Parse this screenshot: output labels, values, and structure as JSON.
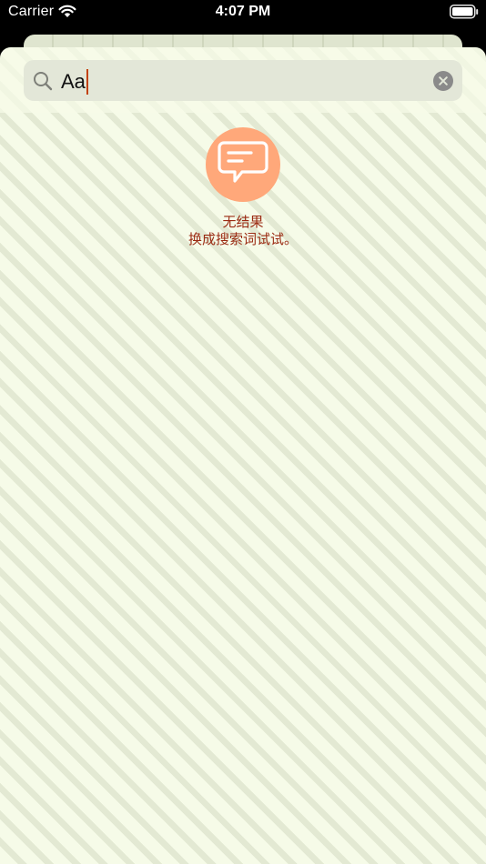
{
  "status_bar": {
    "carrier": "Carrier",
    "time": "4:07 PM",
    "icons": [
      "wifi-icon",
      "battery-icon"
    ]
  },
  "search": {
    "value": "Aa",
    "icon": "search-icon",
    "clear_icon": "clear-icon"
  },
  "empty_state": {
    "icon": "chat-bubble-icon",
    "title": "无结果",
    "subtitle": "换成搜索词试试。"
  },
  "colors": {
    "accent_orange": "#ffa87a",
    "message_text": "#9a2a12",
    "background": "#f6fbe8",
    "cursor": "#c2410c"
  }
}
